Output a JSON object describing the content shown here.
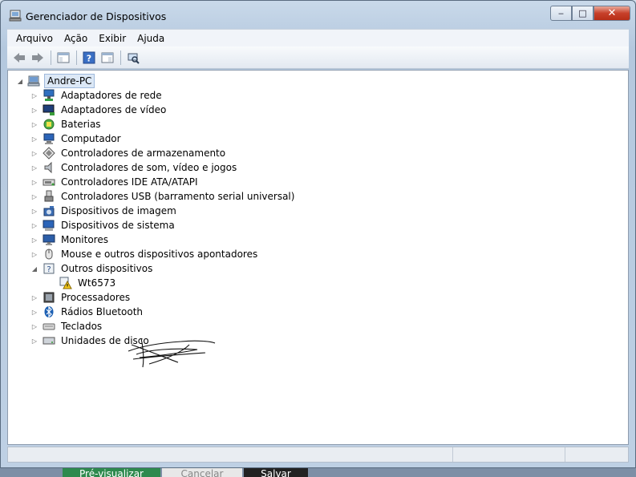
{
  "window": {
    "title": "Gerenciador de Dispositivos",
    "controls": {
      "minimize": "‒",
      "maximize": "□",
      "close": "✕"
    }
  },
  "menu": [
    "Arquivo",
    "Ação",
    "Exibir",
    "Ajuda"
  ],
  "toolbar": {
    "buttons": [
      "back-arrow-icon",
      "forward-arrow-icon",
      "show-hide-console-tree-icon",
      "help-icon",
      "properties-icon",
      "scan-hardware-icon"
    ]
  },
  "tree": {
    "root": "Andre-PC",
    "categories": [
      {
        "label": "Adaptadores de rede",
        "icon": "network-adapter-icon",
        "expanded": false
      },
      {
        "label": "Adaptadores de vídeo",
        "icon": "display-adapter-icon",
        "expanded": false
      },
      {
        "label": "Baterias",
        "icon": "battery-icon",
        "expanded": false
      },
      {
        "label": "Computador",
        "icon": "computer-icon",
        "expanded": false
      },
      {
        "label": "Controladores de armazenamento",
        "icon": "storage-controller-icon",
        "expanded": false
      },
      {
        "label": "Controladores de som, vídeo e jogos",
        "icon": "speaker-icon",
        "expanded": false
      },
      {
        "label": "Controladores IDE ATA/ATAPI",
        "icon": "ide-controller-icon",
        "expanded": false
      },
      {
        "label": "Controladores USB (barramento serial universal)",
        "icon": "usb-icon",
        "expanded": false
      },
      {
        "label": "Dispositivos de imagem",
        "icon": "camera-icon",
        "expanded": false
      },
      {
        "label": "Dispositivos de sistema",
        "icon": "system-device-icon",
        "expanded": false
      },
      {
        "label": "Monitores",
        "icon": "monitor-icon",
        "expanded": false
      },
      {
        "label": "Mouse e outros dispositivos apontadores",
        "icon": "mouse-icon",
        "expanded": false
      },
      {
        "label": "Outros dispositivos",
        "icon": "unknown-device-icon",
        "expanded": true,
        "children": [
          {
            "label": "Wt6573",
            "icon": "warning-device-icon"
          }
        ]
      },
      {
        "label": "Processadores",
        "icon": "processor-icon",
        "expanded": false
      },
      {
        "label": "Rádios Bluetooth",
        "icon": "bluetooth-icon",
        "expanded": false
      },
      {
        "label": "Teclados",
        "icon": "keyboard-icon",
        "expanded": false
      },
      {
        "label": "Unidades de disco",
        "icon": "disk-drive-icon",
        "expanded": false
      }
    ]
  },
  "background_buttons": {
    "preview": "Pré-visualizar",
    "cancel": "Cancelar",
    "save": "Salvar"
  }
}
